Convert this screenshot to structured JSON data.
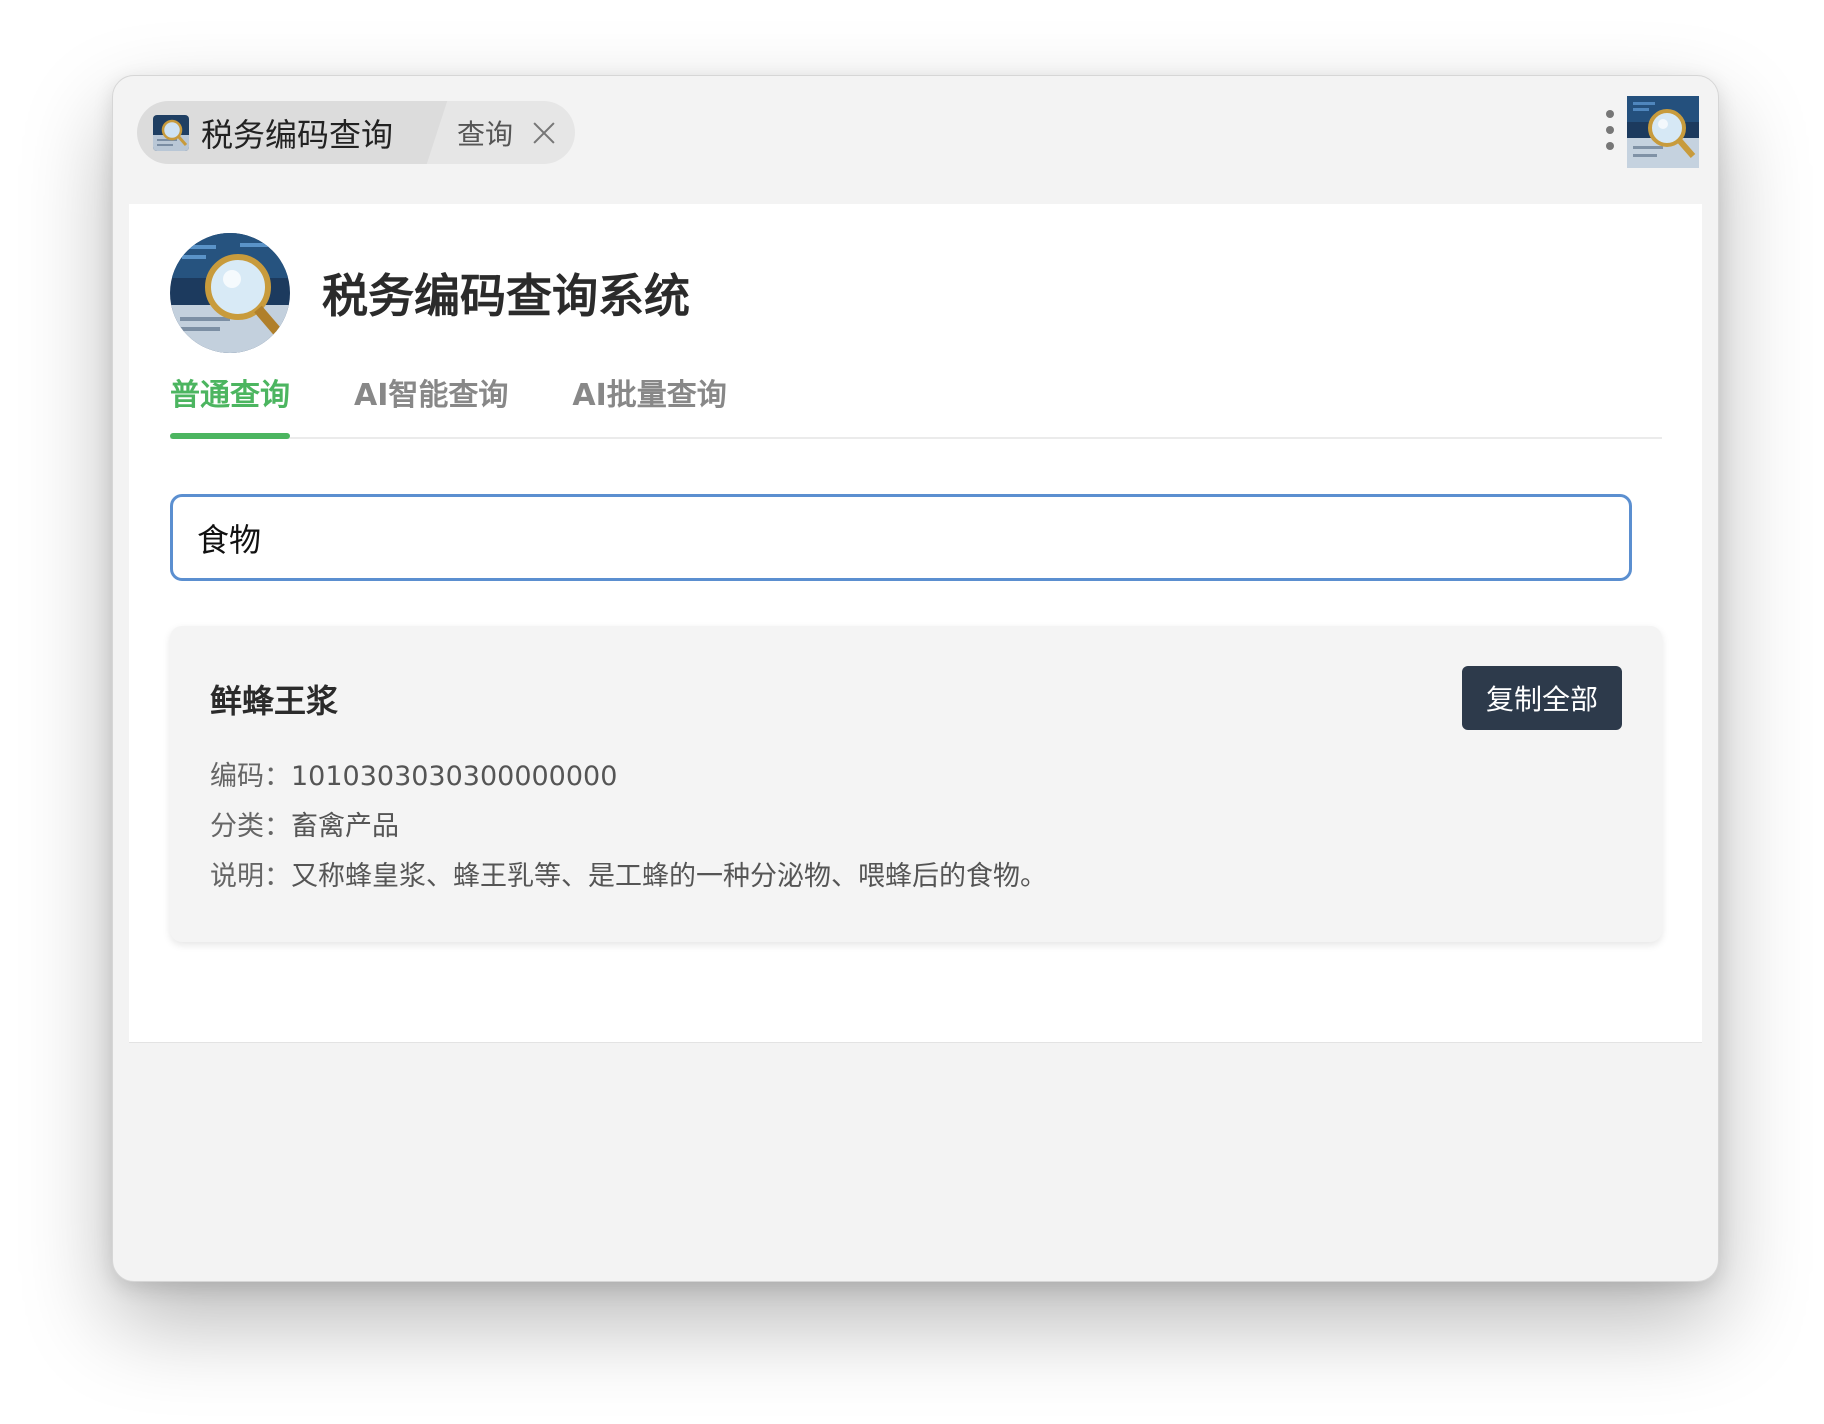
{
  "window": {
    "tab_title": "税务编码查询",
    "tab_subtitle": "查询"
  },
  "icons": {
    "app_thumbnail": "magnifier-document-icon",
    "close": "close-icon",
    "menu": "more-vertical-icon"
  },
  "header": {
    "title": "税务编码查询系统"
  },
  "tabs": [
    {
      "label": "普通查询",
      "active": true
    },
    {
      "label": "AI智能查询",
      "active": false
    },
    {
      "label": "AI批量查询",
      "active": false
    }
  ],
  "search": {
    "value": "食物"
  },
  "result": {
    "name": "鲜蜂王浆",
    "copy_label": "复制全部",
    "code_label": "编码：",
    "code_value": "1010303030300000000",
    "category_label": "分类：",
    "category_value": "畜禽产品",
    "desc_label": "说明：",
    "desc_value": "又称蜂皇浆、蜂王乳等、是工蜂的一种分泌物、喂蜂后的食物。"
  },
  "colors": {
    "accent_green": "#4cb560",
    "search_border": "#5b8fd0",
    "button_dark": "#2d3a4b"
  }
}
